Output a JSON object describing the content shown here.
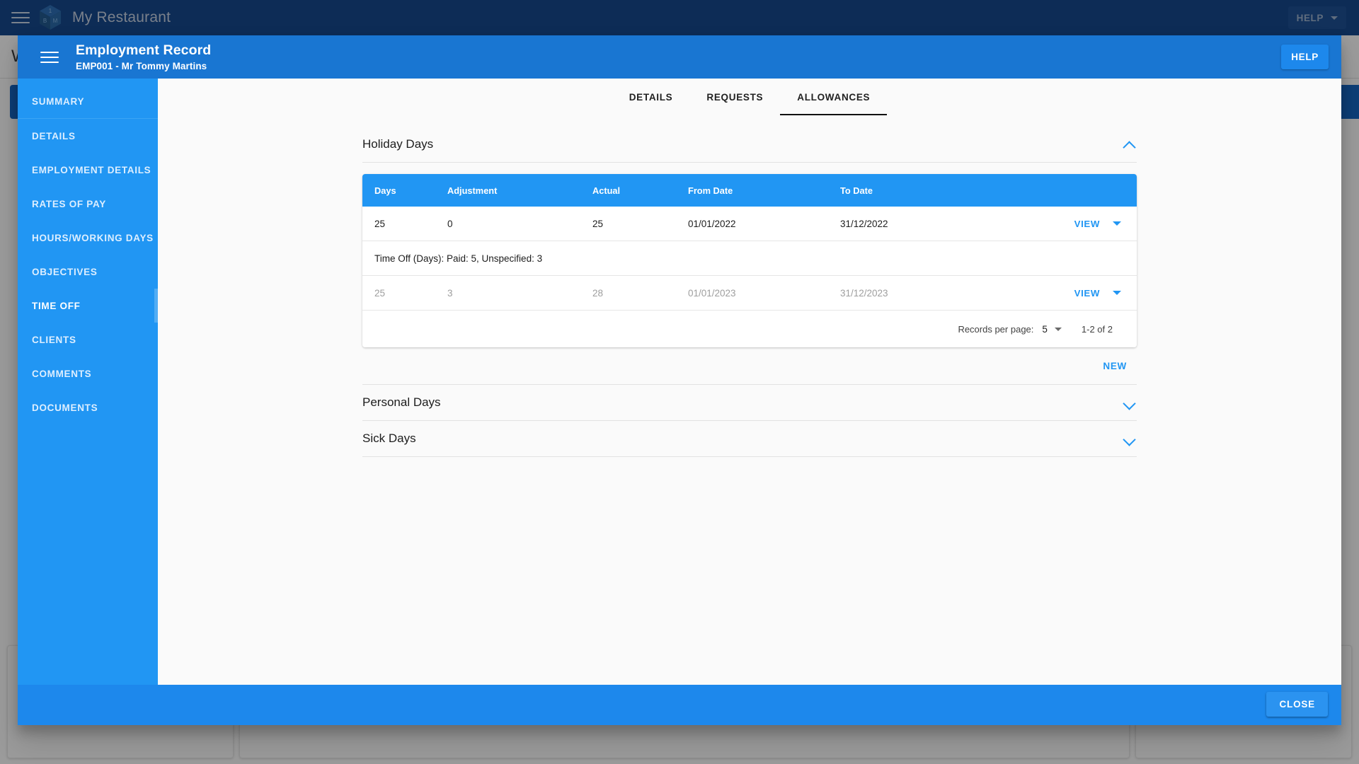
{
  "app": {
    "brand_title": "My Restaurant",
    "logo": {
      "top_letter": "1",
      "left_letter": "B",
      "right_letter": "M"
    },
    "help_label": "HELP",
    "brand_bar_color": "#16478b",
    "accent_color": "#2196f3"
  },
  "background_page": {
    "title": "W"
  },
  "dialog": {
    "title": "Employment Record",
    "subtitle": "EMP001 - Mr Tommy Martins",
    "help_label": "HELP",
    "close_label": "CLOSE"
  },
  "sidebar": {
    "items": [
      {
        "label": "SUMMARY",
        "active": false
      },
      {
        "label": "DETAILS",
        "active": false
      },
      {
        "label": "EMPLOYMENT DETAILS",
        "active": false
      },
      {
        "label": "RATES OF PAY",
        "active": false
      },
      {
        "label": "HOURS/WORKING DAYS",
        "active": false
      },
      {
        "label": "OBJECTIVES",
        "active": false
      },
      {
        "label": "TIME OFF",
        "active": true
      },
      {
        "label": "CLIENTS",
        "active": false
      },
      {
        "label": "COMMENTS",
        "active": false
      },
      {
        "label": "DOCUMENTS",
        "active": false
      }
    ]
  },
  "tabs": [
    {
      "label": "DETAILS",
      "active": false
    },
    {
      "label": "REQUESTS",
      "active": false
    },
    {
      "label": "ALLOWANCES",
      "active": true
    }
  ],
  "panels": {
    "holiday": {
      "title": "Holiday Days",
      "expanded": true,
      "chevron": "chevron-up-icon",
      "table": {
        "columns": [
          "Days",
          "Adjustment",
          "Actual",
          "From Date",
          "To Date"
        ],
        "rows": [
          {
            "days": "25",
            "adjustment": "0",
            "actual": "25",
            "from_date": "01/01/2022",
            "to_date": "31/12/2022",
            "view_label": "VIEW",
            "expanded": true,
            "detail": "Time Off (Days): Paid: 5, Unspecified: 3",
            "muted": false
          },
          {
            "days": "25",
            "adjustment": "3",
            "actual": "28",
            "from_date": "01/01/2023",
            "to_date": "31/12/2023",
            "view_label": "VIEW",
            "expanded": false,
            "detail": "",
            "muted": true
          }
        ],
        "paginator": {
          "label": "Records per page:",
          "value": "5",
          "range": "1-2 of 2"
        }
      },
      "new_label": "NEW"
    },
    "personal": {
      "title": "Personal Days",
      "expanded": false,
      "chevron": "chevron-down-icon"
    },
    "sick": {
      "title": "Sick Days",
      "expanded": false,
      "chevron": "chevron-down-icon"
    }
  }
}
